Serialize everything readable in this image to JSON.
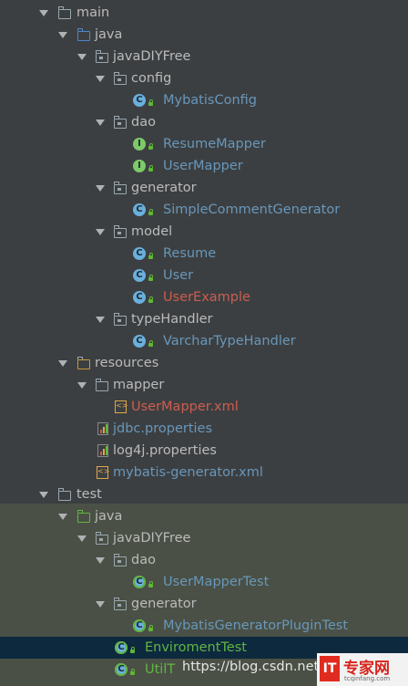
{
  "tree": {
    "main": "main",
    "main_java": "java",
    "javaDIYFree": "javaDIYFree",
    "config": "config",
    "MybatisConfig": "MybatisConfig",
    "dao": "dao",
    "ResumeMapper": "ResumeMapper",
    "UserMapper": "UserMapper",
    "generator": "generator",
    "SimpleCommentGenerator": "SimpleCommentGenerator",
    "model": "model",
    "Resume": "Resume",
    "User": "User",
    "UserExample": "UserExample",
    "typeHandler": "typeHandler",
    "VarcharTypeHandler": "VarcharTypeHandler",
    "resources": "resources",
    "mapper": "mapper",
    "UserMapper_xml": "UserMapper.xml",
    "jdbc_properties": "jdbc.properties",
    "log4j_properties": "log4j.properties",
    "mybatis_generator_xml": "mybatis-generator.xml",
    "test": "test",
    "test_java": "java",
    "test_javaDIYFree": "javaDIYFree",
    "test_dao": "dao",
    "UserMapperTest": "UserMapperTest",
    "test_generator": "generator",
    "MybatisGeneratorPluginTest": "MybatisGeneratorPluginTest",
    "EnviromentTest": "EnviromentTest",
    "UtilTest_partial": "UtilT"
  },
  "watermark": {
    "url": "https://blog.csdn.net/q",
    "logo_it": "IT",
    "logo_text": "专家网",
    "logo_sub": "tcqinfang.com"
  },
  "colors": {
    "background": "#3c3f41",
    "test_background": "#4a5045",
    "selection": "#0d293e",
    "class_label": "#6897bb",
    "modified_label": "#cc5d50",
    "test_label": "#62b543"
  }
}
